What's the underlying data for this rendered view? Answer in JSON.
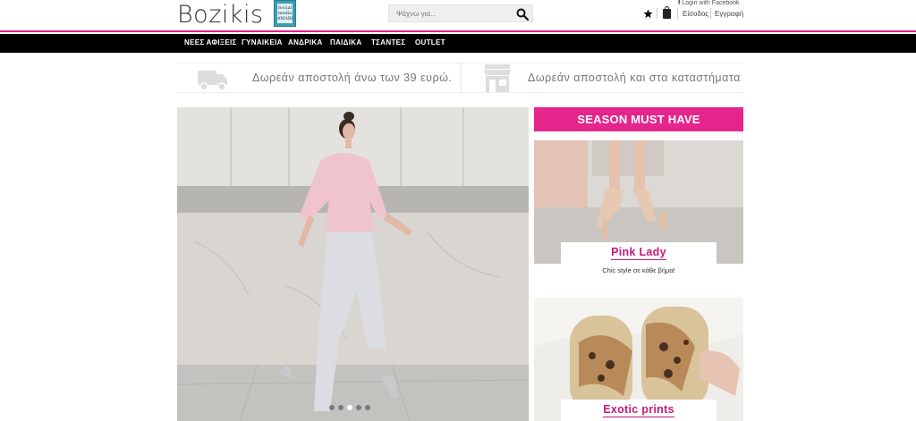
{
  "header": {
    "logo": "Bozikis",
    "award_text": "Social media AWARDS",
    "search_placeholder": "Ψάχνω για...",
    "fb_login": "Login with Facebook",
    "login": "Είσοδος",
    "register": "Εγγραφή"
  },
  "nav": {
    "items": [
      "ΝΕΕΣ ΑΦΙΞΕΙΣ",
      "ΓΥΝΑΙΚΕΙΑ",
      "ΑΝΔΡΙΚΑ",
      "ΠΑΙΔΙΚΑ",
      "ΤΣΑΝΤΕΣ",
      "OUTLET"
    ]
  },
  "shipping": {
    "free_over": "Δωρεάν αποστολή άνω των 39 ευρώ.",
    "free_stores": "Δωρεάν αποστολή και στα καταστήματα"
  },
  "hero": {
    "slide_count": 5,
    "active_slide": 2
  },
  "sidebar": {
    "heading": "SEASON MUST HAVE",
    "promos": [
      {
        "title": "Pink Lady",
        "subtitle": "Chic style σε κάθε βήμα!"
      },
      {
        "title": "Exotic prints"
      }
    ]
  },
  "colors": {
    "accent": "#e5258c",
    "nav_bg": "#000000"
  }
}
